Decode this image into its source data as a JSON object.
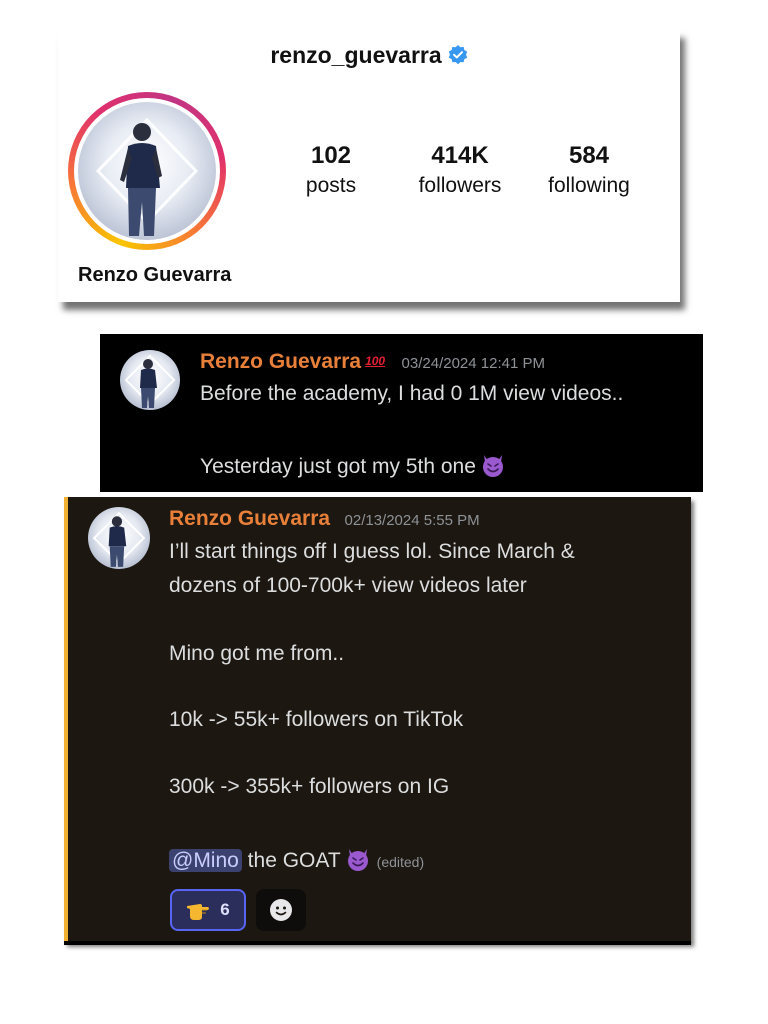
{
  "instagram": {
    "username": "renzo_guevarra",
    "display_name": "Renzo Guevarra",
    "stats": [
      {
        "value": "102",
        "label": "posts"
      },
      {
        "value": "414K",
        "label": "followers"
      },
      {
        "value": "584",
        "label": "following"
      }
    ]
  },
  "message1": {
    "author": "Renzo Guevarra",
    "author_badge": "100",
    "timestamp": "03/24/2024 12:41 PM",
    "line1": "Before the academy, I had 0 1M view videos..",
    "line2": "Yesterday just got my 5th one"
  },
  "message2": {
    "author": "Renzo Guevarra",
    "timestamp": "02/13/2024 5:55 PM",
    "line1": "I’ll start things off I guess lol. Since March &",
    "line2": "dozens of 100-700k+ view videos later",
    "line3": "Mino got me from..",
    "line4": "10k -> 55k+ followers on TikTok",
    "line5": "300k -> 355k+ followers on IG",
    "mention": "@Mino",
    "line6_rest": " the GOAT",
    "edited": "(edited)",
    "reaction_count": "6"
  },
  "colors": {
    "author": "#e8803a",
    "discord_bg_1": "#000000",
    "discord_bg_2": "#1c1710",
    "highlight_bar": "#f0b132",
    "verified": "#3897f0"
  },
  "icons": [
    "verified-badge-icon",
    "hundred-emoji-icon",
    "smiling-imp-emoji-icon",
    "pointing-hand-emoji-icon",
    "add-reaction-icon"
  ]
}
